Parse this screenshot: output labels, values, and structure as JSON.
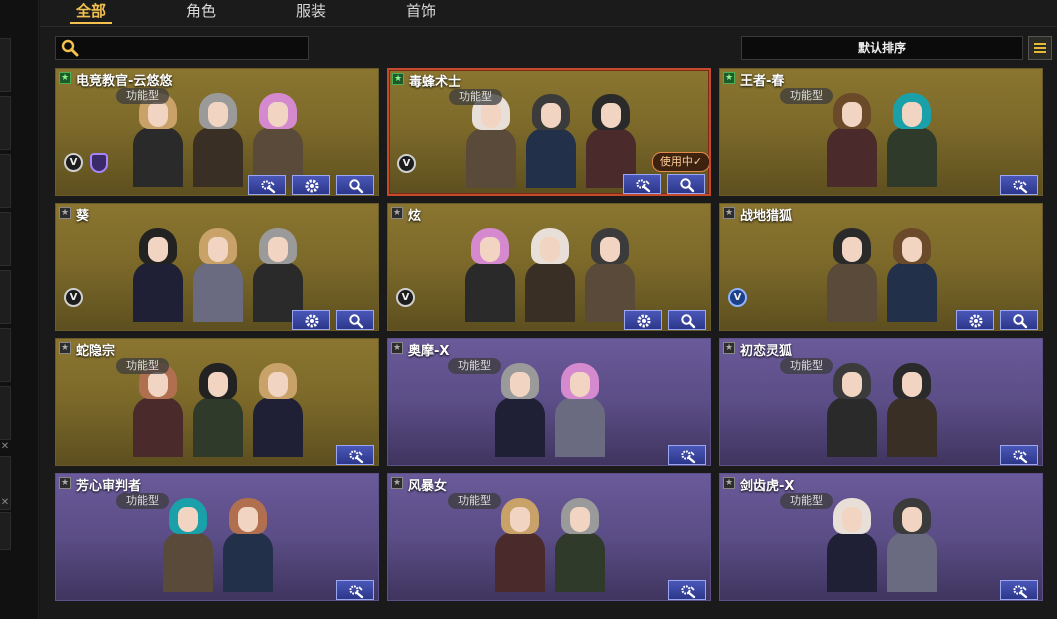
{
  "tabs": [
    {
      "label": "全部",
      "active": true
    },
    {
      "label": "角色",
      "active": false
    },
    {
      "label": "服装",
      "active": false
    },
    {
      "label": "首饰",
      "active": false
    }
  ],
  "search": {
    "placeholder": "",
    "value": ""
  },
  "sort": {
    "label": "默认排序"
  },
  "colors": {
    "accent": "#f2c14e",
    "button": "#3a46a8",
    "gold_card": "#7d6a2a",
    "purple_card": "#5b4d86",
    "selected_border": "#c34a2a"
  },
  "cards": [
    {
      "name": "电竞教官-云悠悠",
      "type": "功能型",
      "rarity": "gold",
      "star": "green",
      "badges": [
        "v-badge",
        "shield-badge"
      ],
      "buttons": [
        "skill",
        "settings",
        "search"
      ],
      "selected": false
    },
    {
      "name": "毒蜂术士",
      "type": "功能型",
      "rarity": "gold",
      "star": "green",
      "badges": [
        "v-badge"
      ],
      "buttons": [
        "skill",
        "search"
      ],
      "selected": true,
      "status": "使用中✓"
    },
    {
      "name": "王者-春",
      "type": "功能型",
      "rarity": "gold",
      "star": "green",
      "badges": [],
      "buttons": [
        "skill"
      ],
      "selected": false
    },
    {
      "name": "葵",
      "type": "",
      "rarity": "gold",
      "star": "gray",
      "badges": [
        "v-badge"
      ],
      "buttons": [
        "settings",
        "search"
      ],
      "selected": false
    },
    {
      "name": "炫",
      "type": "",
      "rarity": "gold",
      "star": "gray",
      "badges": [
        "v-badge"
      ],
      "buttons": [
        "settings",
        "search"
      ],
      "selected": false
    },
    {
      "name": "战地猎狐",
      "type": "",
      "rarity": "gold",
      "star": "gray",
      "badges": [
        "v-badge-blue"
      ],
      "buttons": [
        "settings",
        "search"
      ],
      "selected": false
    },
    {
      "name": "蛇隐宗",
      "type": "功能型",
      "rarity": "gold",
      "star": "gray",
      "badges": [],
      "buttons": [
        "skill"
      ],
      "selected": false
    },
    {
      "name": "奥摩-X",
      "type": "功能型",
      "rarity": "purple",
      "star": "gray",
      "badges": [],
      "buttons": [
        "skill"
      ],
      "selected": false
    },
    {
      "name": "初恋灵狐",
      "type": "功能型",
      "rarity": "purple",
      "star": "gray",
      "badges": [],
      "buttons": [
        "skill"
      ],
      "selected": false
    },
    {
      "name": "芳心审判者",
      "type": "功能型",
      "rarity": "purple",
      "star": "gray",
      "badges": [],
      "buttons": [
        "skill"
      ],
      "selected": false
    },
    {
      "name": "风暴女",
      "type": "功能型",
      "rarity": "purple",
      "star": "gray",
      "badges": [],
      "buttons": [
        "skill"
      ],
      "selected": false
    },
    {
      "name": "剑齿虎-X",
      "type": "功能型",
      "rarity": "purple",
      "star": "gray",
      "badges": [],
      "buttons": [
        "skill"
      ],
      "selected": false
    }
  ]
}
